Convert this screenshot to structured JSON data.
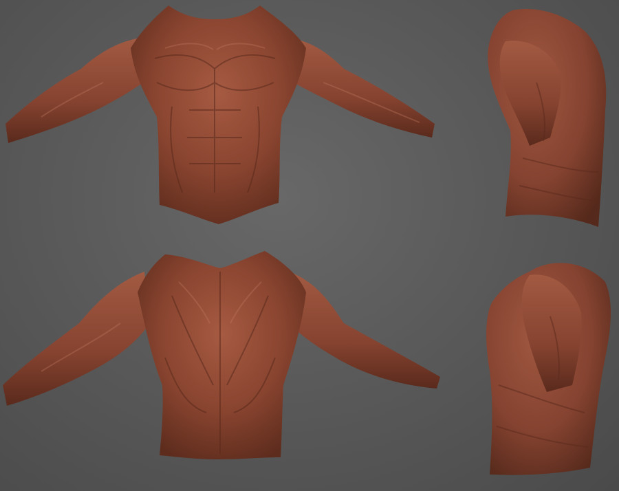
{
  "scene": {
    "background_color": "#5e5e5e",
    "clay_color": "#8a4530",
    "clay_highlight": "#b8705a",
    "clay_shadow": "#5a2a1c",
    "views": [
      {
        "id": "front",
        "subject": "torso-front"
      },
      {
        "id": "back",
        "subject": "torso-back"
      },
      {
        "id": "side-right-upper",
        "subject": "torso-side"
      },
      {
        "id": "side-left-lower",
        "subject": "torso-side"
      }
    ]
  }
}
